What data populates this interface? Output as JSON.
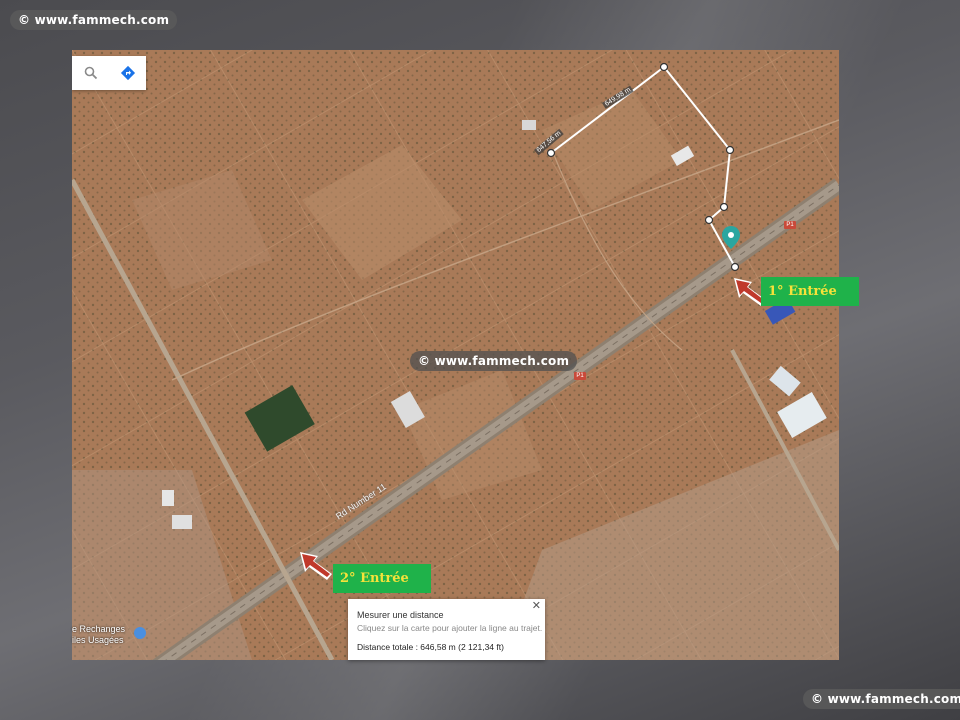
{
  "watermarks": {
    "top_left": "© www.fammech.com",
    "center": "© www.fammech.com",
    "bottom_right": "© www.fammech.com"
  },
  "map": {
    "search_icon": "search-icon",
    "directions_icon": "directions-icon",
    "road_name": "Rd Number 11",
    "road_badge": "P1",
    "segment_labels": [
      "647,56 m",
      "649,98 m"
    ],
    "place_label_line1": "e Rechanges",
    "place_label_line2": "iles Usagées",
    "entries": {
      "first": "1° Entrée",
      "second": "2° Entrée"
    },
    "measure": {
      "title": "Mesurer une distance",
      "hint": "Cliquez sur la carte pour ajouter la ligne au trajet.",
      "total": "Distance totale : 646,58 m (2 121,34 ft)",
      "close_icon": "close-icon"
    },
    "colors": {
      "entry_bg": "#1fb24a",
      "entry_text": "#f6e23a",
      "arrow": "#c0392b",
      "terrain": "#a97a58"
    }
  }
}
